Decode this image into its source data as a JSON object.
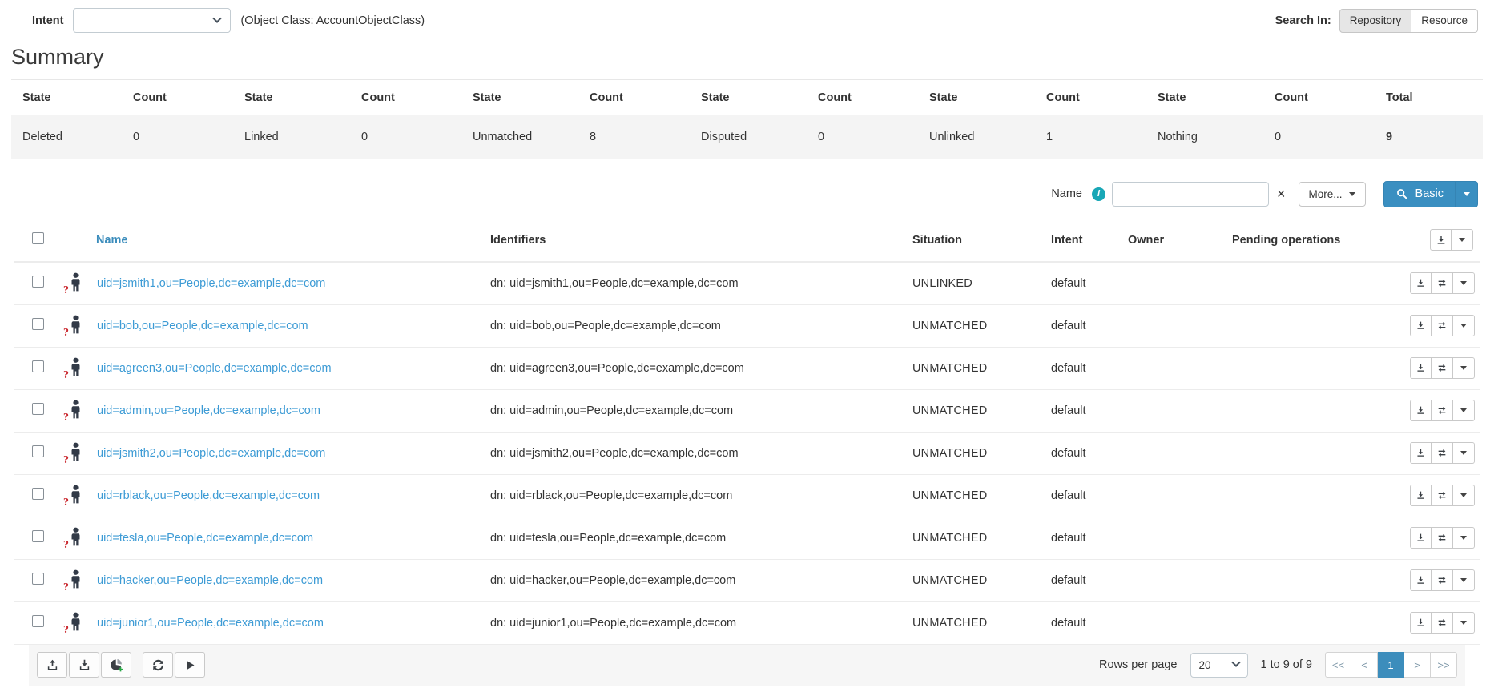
{
  "topbar": {
    "intent_label": "Intent",
    "intent_value": "",
    "object_class": "(Object Class: AccountObjectClass)",
    "search_in_label": "Search In:",
    "repository_label": "Repository",
    "resource_label": "Resource",
    "search_in_selected": "Repository"
  },
  "summary": {
    "title": "Summary",
    "state_header": "State",
    "count_header": "Count",
    "total_header": "Total",
    "pairs": [
      {
        "state": "Deleted",
        "count": "0"
      },
      {
        "state": "Linked",
        "count": "0"
      },
      {
        "state": "Unmatched",
        "count": "8"
      },
      {
        "state": "Disputed",
        "count": "0"
      },
      {
        "state": "Unlinked",
        "count": "1"
      },
      {
        "state": "Nothing",
        "count": "0"
      }
    ],
    "total": "9"
  },
  "search": {
    "field_label": "Name",
    "info_icon": "i",
    "input_value": "",
    "clear_label": "×",
    "more_label": "More...",
    "mode_label": "Basic"
  },
  "table": {
    "headers": {
      "name": "Name",
      "identifiers": "Identifiers",
      "situation": "Situation",
      "intent": "Intent",
      "owner": "Owner",
      "pending": "Pending operations"
    },
    "rows": [
      {
        "name": "uid=jsmith1,ou=People,dc=example,dc=com",
        "identifiers": "dn: uid=jsmith1,ou=People,dc=example,dc=com",
        "situation": "UNLINKED",
        "intent": "default",
        "owner": "",
        "pending": ""
      },
      {
        "name": "uid=bob,ou=People,dc=example,dc=com",
        "identifiers": "dn: uid=bob,ou=People,dc=example,dc=com",
        "situation": "UNMATCHED",
        "intent": "default",
        "owner": "",
        "pending": ""
      },
      {
        "name": "uid=agreen3,ou=People,dc=example,dc=com",
        "identifiers": "dn: uid=agreen3,ou=People,dc=example,dc=com",
        "situation": "UNMATCHED",
        "intent": "default",
        "owner": "",
        "pending": ""
      },
      {
        "name": "uid=admin,ou=People,dc=example,dc=com",
        "identifiers": "dn: uid=admin,ou=People,dc=example,dc=com",
        "situation": "UNMATCHED",
        "intent": "default",
        "owner": "",
        "pending": ""
      },
      {
        "name": "uid=jsmith2,ou=People,dc=example,dc=com",
        "identifiers": "dn: uid=jsmith2,ou=People,dc=example,dc=com",
        "situation": "UNMATCHED",
        "intent": "default",
        "owner": "",
        "pending": ""
      },
      {
        "name": "uid=rblack,ou=People,dc=example,dc=com",
        "identifiers": "dn: uid=rblack,ou=People,dc=example,dc=com",
        "situation": "UNMATCHED",
        "intent": "default",
        "owner": "",
        "pending": ""
      },
      {
        "name": "uid=tesla,ou=People,dc=example,dc=com",
        "identifiers": "dn: uid=tesla,ou=People,dc=example,dc=com",
        "situation": "UNMATCHED",
        "intent": "default",
        "owner": "",
        "pending": ""
      },
      {
        "name": "uid=hacker,ou=People,dc=example,dc=com",
        "identifiers": "dn: uid=hacker,ou=People,dc=example,dc=com",
        "situation": "UNMATCHED",
        "intent": "default",
        "owner": "",
        "pending": ""
      },
      {
        "name": "uid=junior1,ou=People,dc=example,dc=com",
        "identifiers": "dn: uid=junior1,ou=People,dc=example,dc=com",
        "situation": "UNMATCHED",
        "intent": "default",
        "owner": "",
        "pending": ""
      }
    ]
  },
  "footer": {
    "rows_per_page_label": "Rows per page",
    "rows_per_page_value": "20",
    "range_text": "1 to 9 of 9",
    "pag_first": "<<",
    "pag_prev": "<",
    "page_1": "1",
    "pag_next": ">",
    "pag_last": ">>",
    "active_page": "1"
  },
  "colors": {
    "accent_blue": "#3c8dbc",
    "link_blue": "#3d9bd5",
    "info_teal": "#18a7b6",
    "badge_red": "#c9252c",
    "row_stripe": "#f4f4f4"
  }
}
